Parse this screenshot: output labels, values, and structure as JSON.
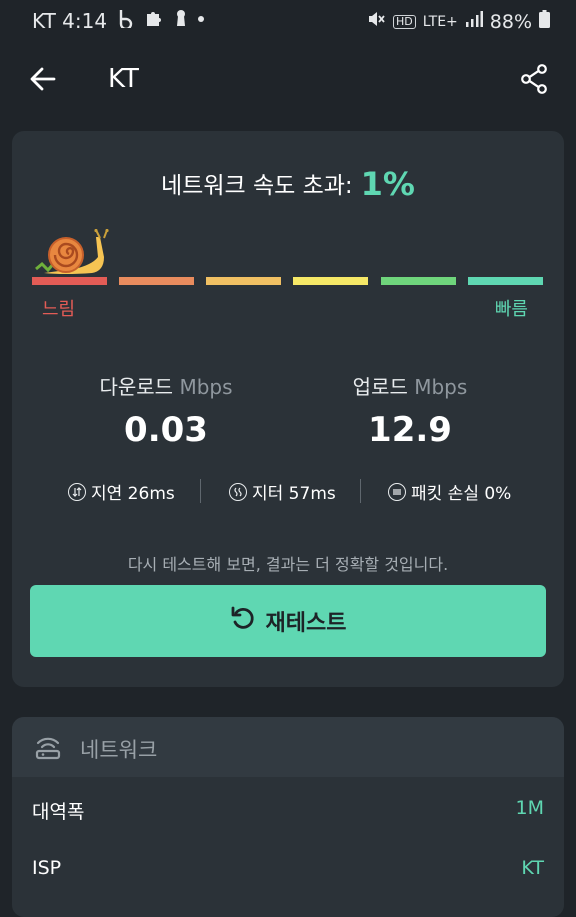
{
  "status_bar": {
    "carrier_time": "KT 4:14",
    "network": "LTE+",
    "battery": "88%"
  },
  "app_bar": {
    "title": "KT",
    "back_icon": "arrow-left-icon",
    "share_icon": "share-icon"
  },
  "result": {
    "headline_label": "네트워크 속도 초과:",
    "headline_percent": "1%",
    "scale_slow": "느림",
    "scale_fast": "빠름",
    "scale_colors": [
      "#e35c56",
      "#e98c5e",
      "#f0c063",
      "#f6e867",
      "#6fd57c",
      "#5fd7b2"
    ],
    "download": {
      "label": "다운로드",
      "unit": "Mbps",
      "value": "0.03"
    },
    "upload": {
      "label": "업로드",
      "unit": "Mbps",
      "value": "12.9"
    },
    "latency": "지연 26ms",
    "jitter": "지터 57ms",
    "packet_loss": "패킷 손실 0%",
    "hint": "다시 테스트해 보면, 결과는 더 정확할 것입니다.",
    "retest_label": "재테스트"
  },
  "network": {
    "title": "네트워크",
    "rows": [
      {
        "key": "대역폭",
        "value": "1M"
      },
      {
        "key": "ISP",
        "value": "KT"
      }
    ]
  },
  "colors": {
    "accent": "#5fd7b2",
    "background": "#1f2429",
    "card": "#2b3238"
  }
}
